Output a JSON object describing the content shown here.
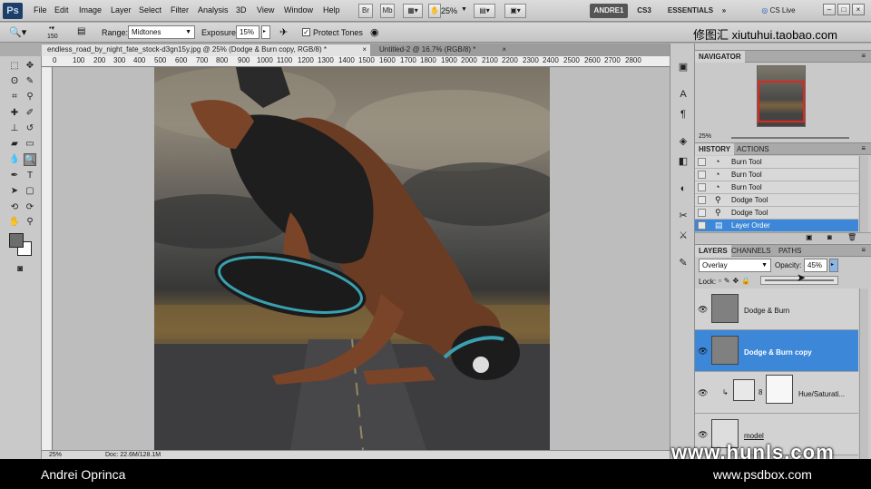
{
  "menubar": {
    "logo": "Ps",
    "items": [
      "File",
      "Edit",
      "Image",
      "Layer",
      "Select",
      "Filter",
      "Analysis",
      "3D",
      "View",
      "Window",
      "Help"
    ],
    "btn_br": "Br",
    "btn_mb": "Mb",
    "zoom": "25%",
    "workspaces": [
      "ANDRE1",
      "CS3",
      "ESSENTIALS"
    ],
    "cs_live": "CS Live",
    "win_controls": [
      "–",
      "□",
      "×"
    ]
  },
  "options": {
    "brush_size": "150",
    "range_label": "Range:",
    "range_value": "Midtones",
    "exposure_label": "Exposure:",
    "exposure_value": "15%",
    "protect_label": "Protect Tones",
    "watermark": "修图汇  xiutuhui.taobao.com"
  },
  "doctabs": [
    {
      "label": "endless_road_by_night_fate_stock-d3gn15y.jpg @ 25% (Dodge & Burn copy, RGB/8) *",
      "close": "×"
    },
    {
      "label": "Untitled-2 @ 16.7% (RGB/8) *",
      "close": "×"
    }
  ],
  "ruler": [
    "0",
    "100",
    "200",
    "300",
    "400",
    "500",
    "600",
    "700",
    "800",
    "900",
    "1000",
    "1100",
    "1200",
    "1300",
    "1400",
    "1500",
    "1600",
    "1700",
    "1800",
    "1900",
    "2000",
    "2100",
    "2200",
    "2300",
    "2400",
    "2500",
    "2600",
    "2700",
    "2800"
  ],
  "status": {
    "zoom": "25%",
    "doc": "Doc: 22.6M/128.1M"
  },
  "navigator": {
    "tab": "NAVIGATOR",
    "zoom": "25%"
  },
  "history": {
    "tabs": [
      "HISTORY",
      "ACTIONS"
    ],
    "items": [
      {
        "label": "Burn Tool"
      },
      {
        "label": "Burn Tool"
      },
      {
        "label": "Burn Tool"
      },
      {
        "label": "Dodge Tool"
      },
      {
        "label": "Dodge Tool"
      },
      {
        "label": "Layer Order"
      }
    ]
  },
  "layers": {
    "tabs": [
      "LAYERS",
      "CHANNELS",
      "PATHS"
    ],
    "blend_mode": "Overlay",
    "opacity_label": "Opacity:",
    "opacity_value": "45%",
    "lock_label": "Lock:",
    "items": [
      {
        "name": "Dodge & Burn"
      },
      {
        "name": "Dodge & Burn copy"
      },
      {
        "name": "Hue/Saturati..."
      },
      {
        "name": "model"
      }
    ]
  },
  "caption": {
    "author": "Andrei Oprinca",
    "site": "www.psdbox.com",
    "watermark": "www.hunls.com"
  },
  "colors": {
    "selection": "#3c87d8",
    "foreground": "#6d6d6d",
    "background": "#ffffff"
  }
}
